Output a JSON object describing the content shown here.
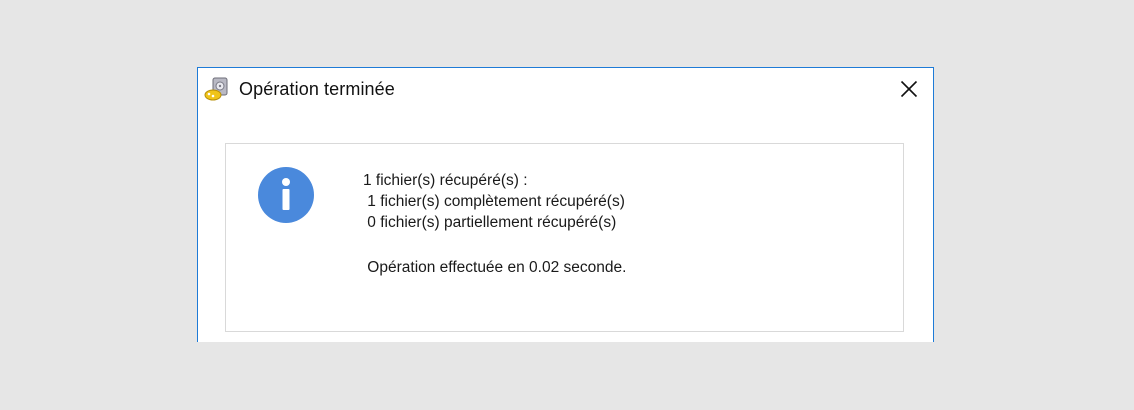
{
  "window": {
    "title": "Opération terminée",
    "app_icon": "recovery-app-icon",
    "close_icon": "close-icon"
  },
  "message": {
    "icon": "info-icon",
    "line1": "1 fichier(s) récupéré(s) :",
    "line2": " 1 fichier(s) complètement récupéré(s)",
    "line3": " 0 fichier(s) partiellement récupéré(s)",
    "line4": " Opération effectuée en 0.02 seconde."
  },
  "colors": {
    "accent_border": "#1e7bd7",
    "info_blue": "#4a89dc"
  }
}
